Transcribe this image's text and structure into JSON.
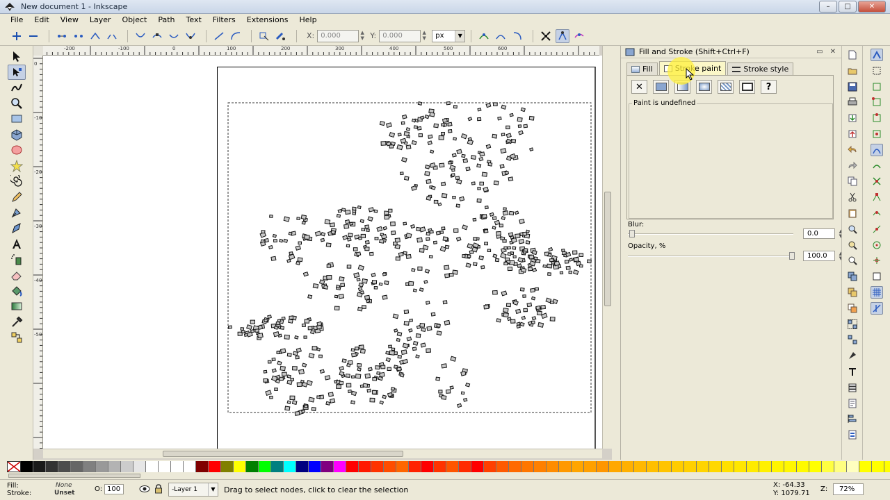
{
  "window": {
    "title": "New document 1 - Inkscape",
    "controls": [
      "–",
      "□",
      "✕"
    ]
  },
  "menu": [
    "File",
    "Edit",
    "View",
    "Layer",
    "Object",
    "Path",
    "Text",
    "Filters",
    "Extensions",
    "Help"
  ],
  "toolbar": {
    "x_label": "X:",
    "x_value": "0.000",
    "y_label": "Y:",
    "y_value": "0.000",
    "unit": "px"
  },
  "rulers": {
    "h_labels": [
      "-200",
      "-100",
      "0",
      "100",
      "200",
      "300",
      "400",
      "500",
      "600"
    ],
    "v_labels": [
      "0",
      "-100",
      "-200",
      "-300",
      "-400",
      "-500"
    ]
  },
  "dock": {
    "title": "Fill and Stroke (Shift+Ctrl+F)",
    "tabs": [
      {
        "label": "Fill",
        "active": false
      },
      {
        "label": "Stroke paint",
        "active": true
      },
      {
        "label": "Stroke style",
        "active": false
      }
    ],
    "paint_status": "Paint is undefined",
    "blur_label": "Blur:",
    "blur_value": "0.0",
    "opacity_label": "Opacity, %",
    "opacity_value": "100.0"
  },
  "palette": [
    "#000000",
    "#1a1a1a",
    "#333333",
    "#4d4d4d",
    "#666666",
    "#808080",
    "#999999",
    "#b3b3b3",
    "#cccccc",
    "#e6e6e6",
    "#ffffff",
    "#ffffff",
    "#ffffff",
    "#ffffff",
    "#800000",
    "#ff0000",
    "#808000",
    "#ffff00",
    "#008000",
    "#00ff00",
    "#008080",
    "#00ffff",
    "#000080",
    "#0000ff",
    "#800080",
    "#ff00ff",
    "#ff0000",
    "#ff1a00",
    "#ff3300",
    "#ff4d00",
    "#ff6600",
    "#ff2200",
    "#ff0000",
    "#ff3300",
    "#ff5500",
    "#ff2b00",
    "#ff0000",
    "#ff4000",
    "#ff5a00",
    "#ff6a00",
    "#ff7700",
    "#ff8000",
    "#ff8c00",
    "#ff9900",
    "#ffa500",
    "#ffa000",
    "#ff9600",
    "#ffa800",
    "#ffb000",
    "#ffb800",
    "#ffbf00",
    "#ffc400",
    "#ffcc00",
    "#ffd000",
    "#ffd400",
    "#ffd800",
    "#ffe000",
    "#ffe600",
    "#ffeb00",
    "#fff000",
    "#fff400",
    "#fff700",
    "#fffa00",
    "#ffff00",
    "#ffff40",
    "#ffff80",
    "#ffffbf",
    "#ffff00",
    "#ffff00",
    "#ffff00",
    "#ffff00"
  ],
  "status": {
    "fill_label": "Fill:",
    "fill_value": "None",
    "stroke_label": "Stroke:",
    "stroke_value": "Unset",
    "opacity_label": "O:",
    "opacity_value": "100",
    "layer": "-Layer 1",
    "message": "Drag to select nodes, click to clear the selection",
    "x": "X:   -64.33",
    "y": "Y: 1079.71",
    "zoom_label": "Z:",
    "zoom": "72%"
  }
}
